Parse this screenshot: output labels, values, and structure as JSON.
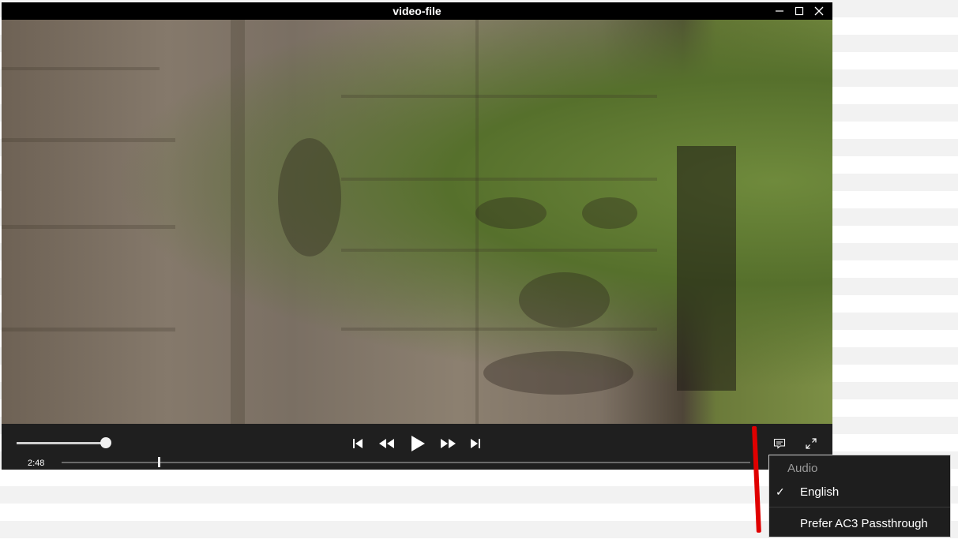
{
  "window": {
    "title": "video-file",
    "buttons": [
      "minimize",
      "maximize",
      "close"
    ]
  },
  "controls": {
    "current_time": "2:48",
    "volume_level": 0.95,
    "seek_progress": 0.14,
    "icons": [
      "skip-previous-icon",
      "rewind-icon",
      "play-icon",
      "fast-forward-icon",
      "skip-next-icon",
      "subtitles-icon",
      "fullscreen-icon"
    ]
  },
  "audio_menu": {
    "header": "Audio",
    "items": [
      {
        "label": "English",
        "checked": true,
        "check_glyph": "✓"
      },
      {
        "label": "Prefer AC3 Passthrough",
        "checked": false
      }
    ]
  },
  "annotation": {
    "color": "#e00000"
  }
}
